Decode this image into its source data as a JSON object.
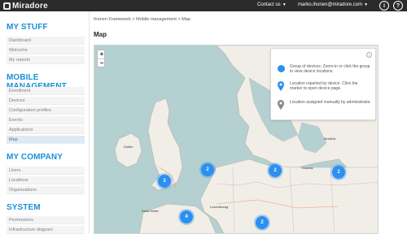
{
  "header": {
    "app_name": "Miradore",
    "contact_label": "Contact us",
    "user_email": "marko.ihonen@miradore.com",
    "info_button": "i",
    "help_button": "?"
  },
  "sidebar": {
    "sections": [
      {
        "title": "MY STUFF",
        "items": [
          "Dashboard",
          "Welcome",
          "My reports"
        ]
      },
      {
        "title": "MOBILE MANAGEMENT",
        "items": [
          "Enrollment",
          "Devices",
          "Configuration profiles",
          "Events",
          "Applications",
          "Map"
        ]
      },
      {
        "title": "MY COMPANY",
        "items": [
          "Users",
          "Locations",
          "Organizations"
        ]
      },
      {
        "title": "SYSTEM",
        "items": [
          "Permissions",
          "Infrastructure diagram"
        ]
      }
    ],
    "active_item": "Map"
  },
  "breadcrumb": "Ihonen Framework > Mobile management > Map",
  "page_title": "Map",
  "map": {
    "zoom_in": "+",
    "zoom_out": "−",
    "clusters": [
      "3",
      "2",
      "2",
      "2",
      "4",
      "2"
    ],
    "labels": [
      "Dublin",
      "Mockba",
      "Saint-Helier",
      "Luxembourg",
      "Kaunas"
    ]
  },
  "legend": {
    "info_icon": "i",
    "group_text": "Group of devices. Zoom-in or click the group to view device locations.",
    "reported_text": "Location reported by device. Click the marker to open device page.",
    "manual_text": "Location assigned manually by administrator."
  },
  "colors": {
    "accent": "#1a8fd6",
    "cluster": "#2d8ff0",
    "topbar": "#2b2b2b",
    "sea": "#b5d0d0",
    "land": "#f1eee8"
  }
}
